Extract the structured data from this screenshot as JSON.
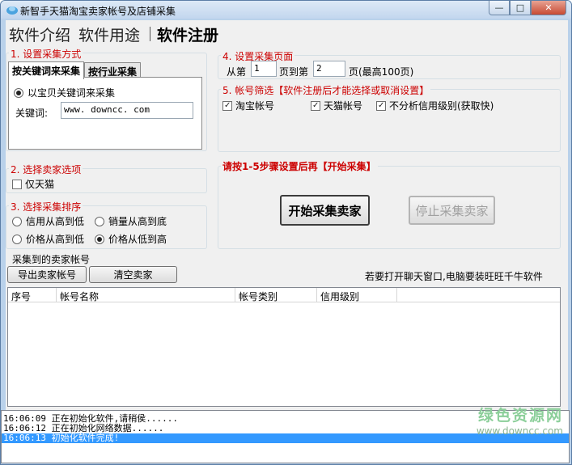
{
  "window": {
    "title": "新智手天猫淘宝卖家帐号及店铺采集",
    "minimize_icon": "minimize-icon",
    "maximize_icon": "maximize-icon",
    "close_icon": "close-icon"
  },
  "nav": {
    "item1": "软件介绍",
    "item2": "软件用途",
    "item3": "软件注册"
  },
  "section1": {
    "label": "1. 设置采集方式",
    "tab1": "按关键词来采集",
    "tab2": "按行业采集",
    "radio_label": "以宝贝关键词来采集",
    "keyword_label": "关键词:",
    "keyword_value": "www. downcc. com"
  },
  "section2": {
    "label": "2. 选择卖家选项",
    "check_label": "仅天猫"
  },
  "section3": {
    "label": "3. 选择采集排序",
    "opt1": "信用从高到低",
    "opt2": "销量从高到底",
    "opt3": "价格从高到低",
    "opt4": "价格从低到高",
    "selected": "价格从低到高"
  },
  "section4": {
    "label": "4. 设置采集页面",
    "from_label": "从第",
    "from_value": "1",
    "to_label": "页到第",
    "to_value": "2",
    "suffix": "页(最高100页)"
  },
  "section5": {
    "label": "5. 帐号筛选【软件注册后才能选择或取消设置】",
    "check1": "淘宝帐号",
    "check2": "天猫帐号",
    "check3": "不分析信用级别(获取快)"
  },
  "section6": {
    "label": "请按1-5步骤设置后再【开始采集】",
    "start_button": "开始采集卖家",
    "stop_button": "停止采集卖家"
  },
  "results": {
    "label": "采集到的卖家帐号",
    "export_button": "导出卖家帐号",
    "clear_button": "清空卖家",
    "hint": "若要打开聊天窗口,电脑要装旺旺千牛软件",
    "columns": [
      "序号",
      "帐号名称",
      "帐号类别",
      "信用级别"
    ]
  },
  "log": [
    "16:06:09 正在初始化软件,请稍侯......",
    "16:06:12 正在初始化网络数据......",
    "16:06:13 初始化软件完成!"
  ],
  "watermark": {
    "line1": "绿色资源网",
    "line2": "www.downcc.com"
  },
  "colors": {
    "accent_red": "#cc0000",
    "selection_blue": "#3399ff",
    "client_bg": "#f0f0f0",
    "frame_blue": "#b9d1ea"
  }
}
